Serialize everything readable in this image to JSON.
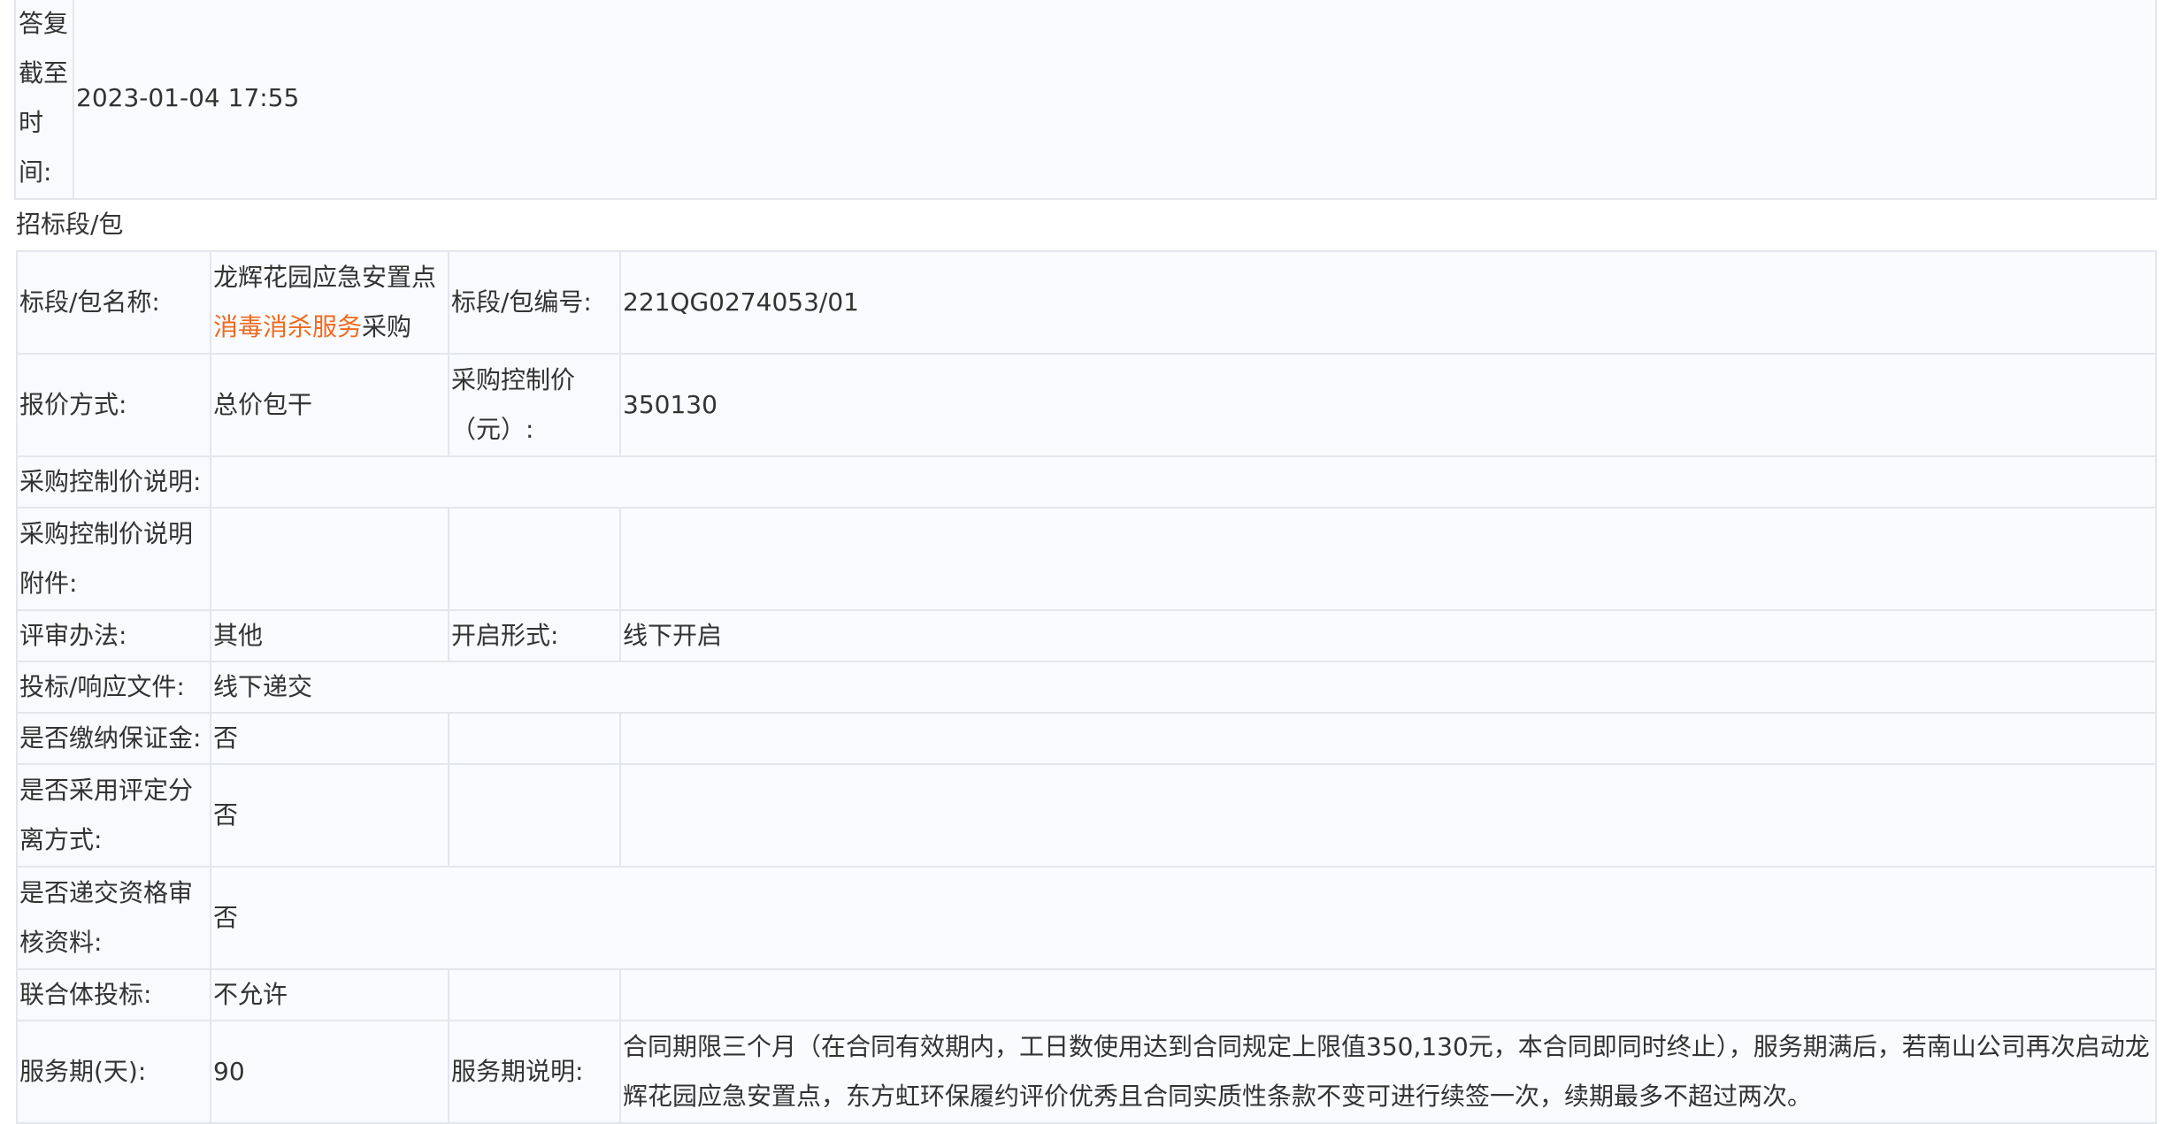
{
  "reply_deadline": {
    "label": "答复截至时间:",
    "value": "2023-01-04 17:55"
  },
  "section_title": "招标段/包",
  "rows": {
    "package_name": {
      "label": "标段/包名称:",
      "value_prefix": "龙辉花园应急安置点",
      "value_highlight": "消毒消杀服务",
      "value_suffix": "采购",
      "label2": "标段/包编号:",
      "value2": "221QG0274053/01"
    },
    "quote_method": {
      "label": "报价方式:",
      "value": "总价包干",
      "label2": "采购控制价（元）:",
      "value2": "350130"
    },
    "control_price_note": {
      "label": "采购控制价说明:",
      "value": ""
    },
    "control_price_attachment": {
      "label": "采购控制价说明附件:",
      "value": ""
    },
    "evaluation": {
      "label": "评审办法:",
      "value": "其他",
      "label2": "开启形式:",
      "value2": "线下开启"
    },
    "bid_docs": {
      "label": "投标/响应文件:",
      "value": "线下递交"
    },
    "deposit": {
      "label": "是否缴纳保证金:",
      "value": "否"
    },
    "separation": {
      "label": "是否采用评定分离方式:",
      "value": "否"
    },
    "qualification": {
      "label": "是否递交资格审核资料:",
      "value": "否"
    },
    "consortium": {
      "label": "联合体投标:",
      "value": "不允许"
    },
    "service_period": {
      "label": "服务期(天):",
      "value": "90",
      "label2": "服务期说明:",
      "value2": "合同期限三个月（在合同有效期内，工日数使用达到合同规定上限值350,130元，本合同即同时终止），服务期满后，若南山公司再次启动龙辉花园应急安置点，东方虹环保履约评价优秀且合同实质性条款不变可进行续签一次，续期最多不超过两次。"
    }
  },
  "colors": {
    "border": "#e3e6ec",
    "label_bg": "#f9fafd",
    "value_bg": "#fafbfe",
    "highlight": "#ee6a1f",
    "text": "#333333"
  }
}
